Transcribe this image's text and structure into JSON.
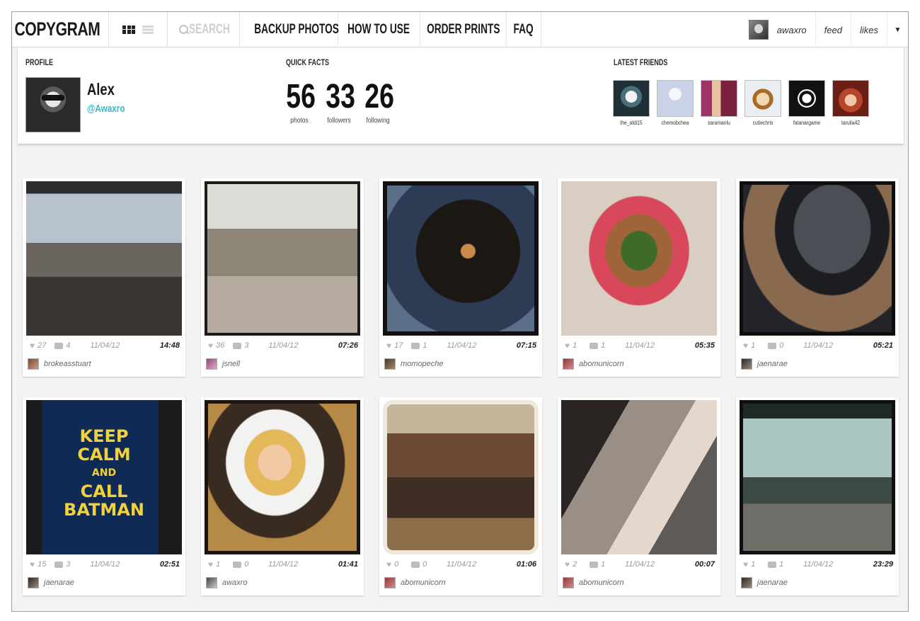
{
  "nav": {
    "logo": "COPYGRAM",
    "search_label": "SEARCH",
    "menu": [
      "BACKUP PHOTOS",
      "HOW TO USE",
      "ORDER PRINTS",
      "FAQ"
    ],
    "user": {
      "username": "awaxro",
      "feed": "feed",
      "likes": "likes",
      "caret": "▼"
    }
  },
  "profile": {
    "section_title": "PROFILE",
    "name": "Alex",
    "handle": "@Awaxro"
  },
  "quick_facts": {
    "section_title": "QUICK FACTS",
    "items": [
      {
        "value": "56",
        "label": "photos"
      },
      {
        "value": "33",
        "label": "followers"
      },
      {
        "value": "26",
        "label": "following"
      }
    ]
  },
  "friends": {
    "section_title": "LATEST FRIENDS",
    "items": [
      {
        "name": "the_aldi15"
      },
      {
        "name": "chemobchea"
      },
      {
        "name": "saramanlu"
      },
      {
        "name": "cutiechris"
      },
      {
        "name": "fatanargame"
      },
      {
        "name": "taruila42"
      }
    ]
  },
  "photos": [
    {
      "likes": "27",
      "comments": "4",
      "date": "11/04/12",
      "time": "14:48",
      "user": "brokeasstuart"
    },
    {
      "likes": "36",
      "comments": "3",
      "date": "11/04/12",
      "time": "07:26",
      "user": "jsnell"
    },
    {
      "likes": "17",
      "comments": "1",
      "date": "11/04/12",
      "time": "07:15",
      "user": "momopeche"
    },
    {
      "likes": "1",
      "comments": "1",
      "date": "11/04/12",
      "time": "05:35",
      "user": "abomunicorn"
    },
    {
      "likes": "1",
      "comments": "0",
      "date": "11/04/12",
      "time": "05:21",
      "user": "jaenarae"
    },
    {
      "likes": "15",
      "comments": "3",
      "date": "11/04/12",
      "time": "02:51",
      "user": "jaenarae"
    },
    {
      "likes": "1",
      "comments": "0",
      "date": "11/04/12",
      "time": "01:41",
      "user": "awaxro"
    },
    {
      "likes": "0",
      "comments": "0",
      "date": "11/04/12",
      "time": "01:06",
      "user": "abomunicorn"
    },
    {
      "likes": "2",
      "comments": "1",
      "date": "11/04/12",
      "time": "00:07",
      "user": "abomunicorn"
    },
    {
      "likes": "1",
      "comments": "1",
      "date": "11/04/12",
      "time": "23:29",
      "user": "jaenarae"
    }
  ],
  "sign": {
    "line1": "KEEP",
    "line2": "CALM",
    "line3": "AND",
    "line4": "CALL",
    "line5": "BATMAN"
  }
}
